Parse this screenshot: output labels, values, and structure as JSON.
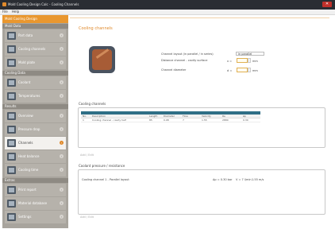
{
  "window": {
    "title": "Mold Cooling Design Calc - Cooling Channels"
  },
  "menu": {
    "file": "File",
    "help": "Help"
  },
  "sidebar": {
    "header": "Mold Cooling Design",
    "sections": {
      "mold_data": "Mold Data",
      "cooling_data": "Cooling Data",
      "results": "Results",
      "extras": "Extras"
    },
    "items": [
      {
        "label": "Part data"
      },
      {
        "label": "Cooling channels"
      },
      {
        "label": "Mold plate"
      },
      {
        "label": "Coolant"
      },
      {
        "label": "Temperatures"
      },
      {
        "label": "Overview"
      },
      {
        "label": "Pressure drop"
      },
      {
        "label": "Channels"
      },
      {
        "label": "Heat balance"
      },
      {
        "label": "Cooling time"
      },
      {
        "label": "Print report"
      },
      {
        "label": "Material database"
      },
      {
        "label": "Settings"
      }
    ]
  },
  "main": {
    "title": "Cooling channels",
    "form": {
      "field1_label": "Channel layout (in parallel / in series)",
      "field1_value": "in parallel",
      "field2_label": "Distance channel - cavity surface",
      "field2_prefix": "x =",
      "field2_unit": "mm",
      "field3_label": "Channel diameter",
      "field3_prefix": "d =",
      "field3_unit": "mm"
    },
    "group1": {
      "label": "Cooling channels",
      "footer": "Add / Edit",
      "columns": [
        "No.",
        "Description",
        "Length",
        "Diameter",
        "Flow",
        "Velocity",
        "Re",
        "Δp"
      ],
      "rows": [
        [
          "1",
          "Cooling channel - cavity half",
          "85",
          "0.08",
          "7",
          "1.55",
          "2880",
          "0.30"
        ]
      ]
    },
    "group2": {
      "label": "Coolant pressure / resistance",
      "footer": "Add / Edit",
      "row_text": "Cooling channel 1 - Parallel layout",
      "row_value1": "Δp = 0.30 bar",
      "row_value2": "V = 7 l/min",
      "row_value3": "1.55 m/s"
    }
  }
}
